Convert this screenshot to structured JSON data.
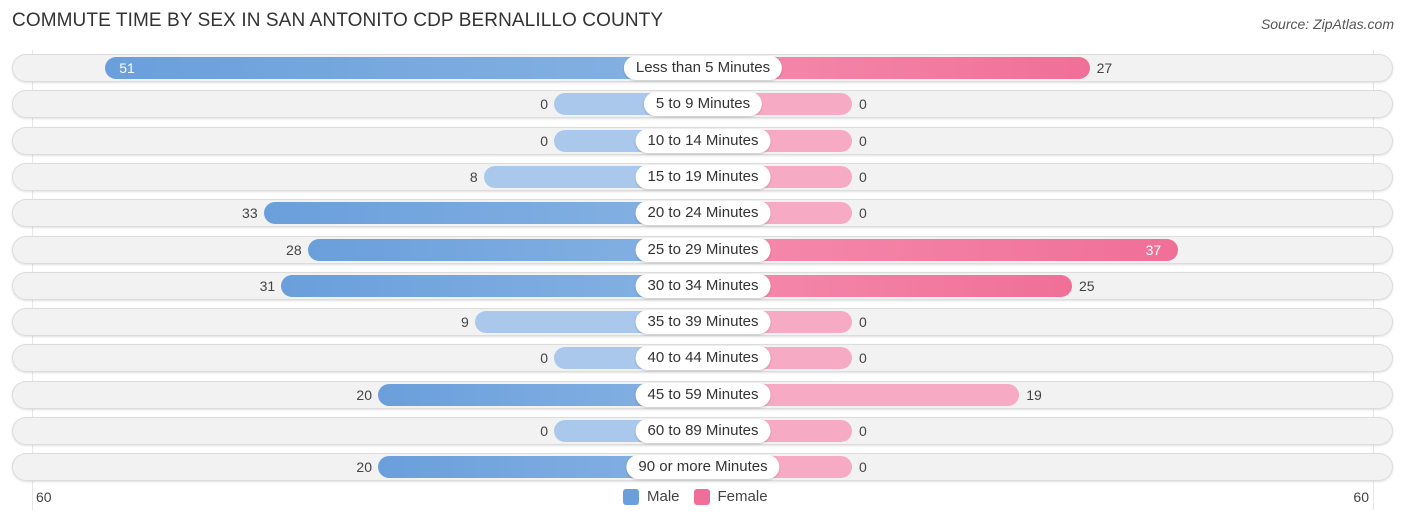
{
  "header": {
    "title": "COMMUTE TIME BY SEX IN SAN ANTONITO CDP BERNALILLO COUNTY",
    "source": "Source: ZipAtlas.com"
  },
  "colors": {
    "male_strong": "#6a9fdb",
    "male_light": "#a9c8ec",
    "female_strong": "#f06f98",
    "female_light": "#f7aac4"
  },
  "chart_data": {
    "type": "bar",
    "orientation": "horizontal-diverging",
    "title": "COMMUTE TIME BY SEX IN SAN ANTONITO CDP BERNALILLO COUNTY",
    "categories": [
      "Less than 5 Minutes",
      "5 to 9 Minutes",
      "10 to 14 Minutes",
      "15 to 19 Minutes",
      "20 to 24 Minutes",
      "25 to 29 Minutes",
      "30 to 34 Minutes",
      "35 to 39 Minutes",
      "40 to 44 Minutes",
      "45 to 59 Minutes",
      "60 to 89 Minutes",
      "90 or more Minutes"
    ],
    "series": [
      {
        "name": "Male",
        "values": [
          51,
          0,
          0,
          8,
          33,
          28,
          31,
          9,
          0,
          20,
          0,
          20
        ]
      },
      {
        "name": "Female",
        "values": [
          27,
          0,
          0,
          0,
          0,
          37,
          25,
          0,
          0,
          19,
          0,
          0
        ]
      }
    ],
    "axis": {
      "left_label": "60",
      "right_label": "60",
      "xlim": [
        -60,
        60
      ]
    },
    "legend": {
      "position": "bottom-center",
      "entries": [
        "Male",
        "Female"
      ]
    }
  }
}
